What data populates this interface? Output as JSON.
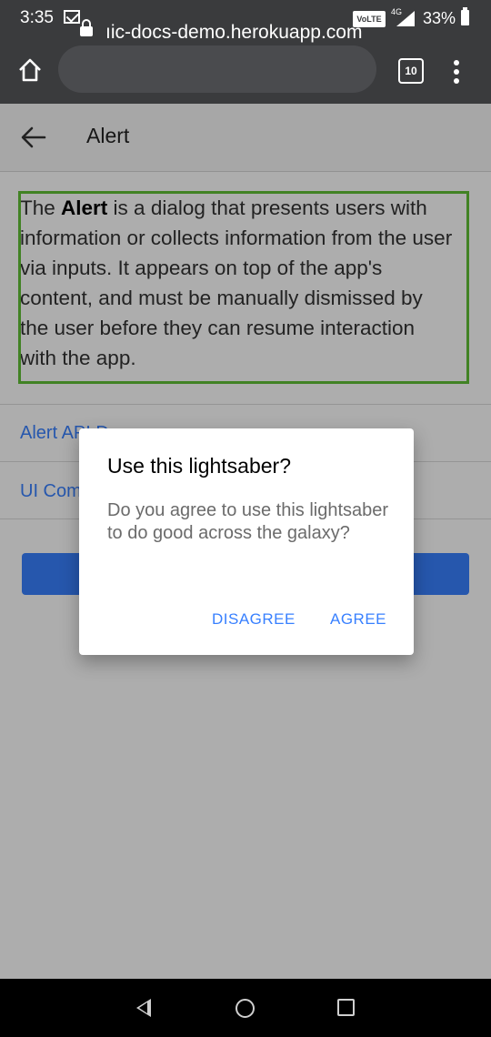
{
  "status_bar": {
    "time": "3:35",
    "volte": "VoLTE",
    "network": "4G",
    "battery": "33%"
  },
  "browser": {
    "url": "ıic-docs-demo.herokuapp.com",
    "tab_count": "10"
  },
  "page": {
    "title": "Alert",
    "description": {
      "pre": "The ",
      "bold": "Alert",
      "post": " is a dialog that presents users with information or collects information from the user via inputs. It appears on top of the app's content, and must be manually dismissed by the user before they can resume interaction with the app."
    },
    "links": [
      {
        "label": "Alert API D"
      },
      {
        "label": "UI Com"
      }
    ]
  },
  "dialog": {
    "title": "Use this lightsaber?",
    "message": "Do you agree to use this lightsaber to do good across the galaxy?",
    "buttons": {
      "disagree": "DISAGREE",
      "agree": "AGREE"
    }
  },
  "colors": {
    "accent": "#3880ff",
    "highlight": "#61c036",
    "chrome": "#3a3b3d"
  }
}
